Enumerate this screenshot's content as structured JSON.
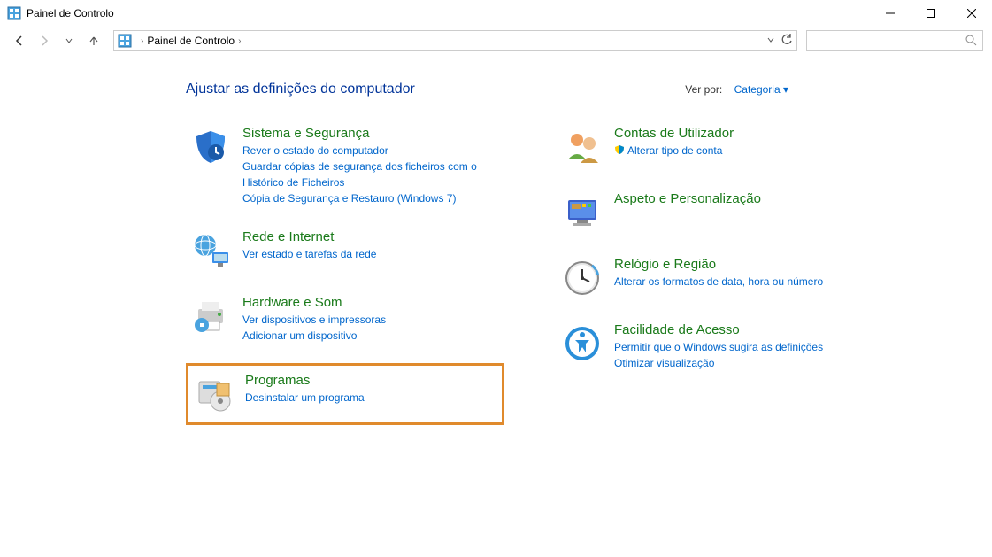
{
  "window": {
    "title": "Painel de Controlo"
  },
  "breadcrumb": {
    "root": "Painel de Controlo"
  },
  "heading": "Ajustar as definições do computador",
  "viewby": {
    "label": "Ver por:",
    "mode": "Categoria"
  },
  "left": [
    {
      "title": "Sistema e Segurança",
      "links": [
        "Rever o estado do computador",
        "Guardar cópias de segurança dos ficheiros com o Histórico de Ficheiros",
        "Cópia de Segurança e Restauro (Windows 7)"
      ]
    },
    {
      "title": "Rede e Internet",
      "links": [
        "Ver estado e tarefas da rede"
      ]
    },
    {
      "title": "Hardware e Som",
      "links": [
        "Ver dispositivos e impressoras",
        "Adicionar um dispositivo"
      ]
    },
    {
      "title": "Programas",
      "links": [
        "Desinstalar um programa"
      ]
    }
  ],
  "right": [
    {
      "title": "Contas de Utilizador",
      "links": [
        "Alterar tipo de conta"
      ],
      "shield": [
        true
      ]
    },
    {
      "title": "Aspeto e Personalização",
      "links": []
    },
    {
      "title": "Relógio e Região",
      "links": [
        "Alterar os formatos de data, hora ou número"
      ]
    },
    {
      "title": "Facilidade de Acesso",
      "links": [
        "Permitir que o Windows sugira as definições",
        "Otimizar visualização"
      ]
    }
  ]
}
